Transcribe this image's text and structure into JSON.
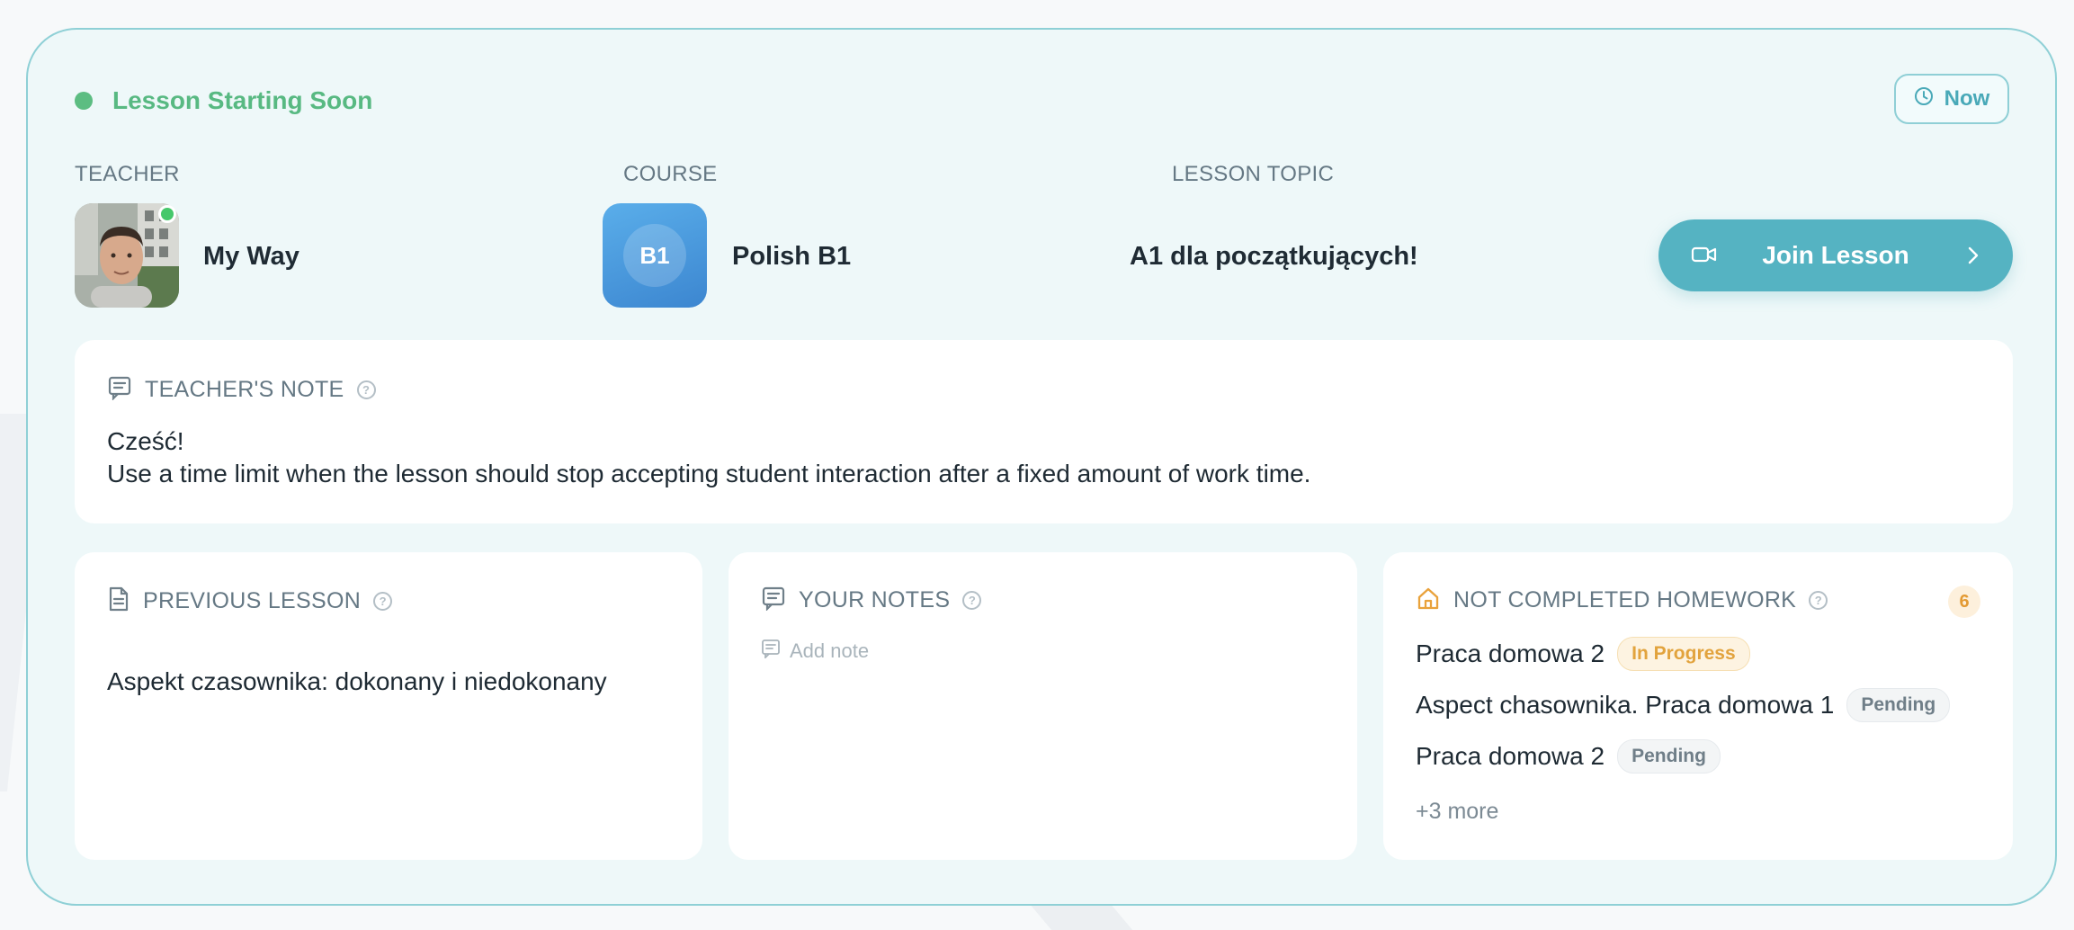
{
  "status": {
    "text": "Lesson Starting Soon",
    "color": "#58b982"
  },
  "time_badge": {
    "label": "Now",
    "icon": "clock-icon"
  },
  "columns": {
    "teacher": {
      "label": "TEACHER",
      "name": "My Way",
      "online": true
    },
    "course": {
      "label": "COURSE",
      "icon_text": "B1",
      "name": "Polish B1"
    },
    "topic": {
      "label": "LESSON TOPIC",
      "value": "A1 dla początkujących!"
    }
  },
  "join_button": {
    "label": "Join Lesson",
    "icon": "video-camera-icon",
    "accent": "#55b3c2"
  },
  "teacher_note": {
    "title": "TEACHER'S NOTE",
    "lines": [
      "Cześć!",
      "Use a time limit when the lesson should stop accepting student interaction after a fixed amount of work time."
    ]
  },
  "previous_lesson": {
    "title": "PREVIOUS LESSON",
    "value": "Aspekt czasownika: dokonany i niedokonany"
  },
  "your_notes": {
    "title": "YOUR NOTES",
    "add_label": "Add note"
  },
  "homework": {
    "title": "NOT COMPLETED HOMEWORK",
    "count": "6",
    "items": [
      {
        "title": "Praca domowa 2",
        "status": "In Progress"
      },
      {
        "title": "Aspect chasownika. Praca domowa 1",
        "status": "Pending"
      },
      {
        "title": "Praca domowa 2",
        "status": "Pending"
      }
    ],
    "more_label": "+3 more"
  }
}
